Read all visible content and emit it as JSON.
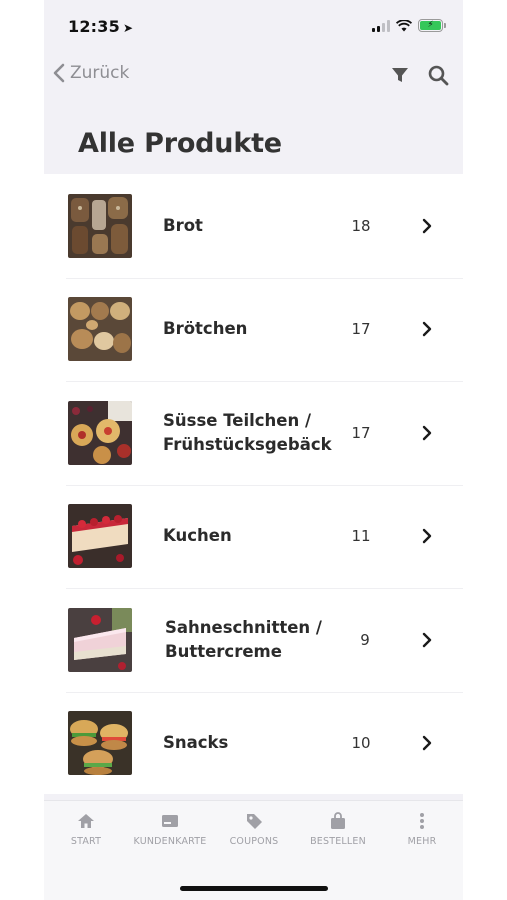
{
  "status": {
    "time": "12:35"
  },
  "nav": {
    "back_label": "Zurück"
  },
  "page": {
    "title": "Alle Produkte"
  },
  "categories": [
    {
      "label": "Brot",
      "count": "18",
      "image": "bread-image"
    },
    {
      "label": "Brötchen",
      "count": "17",
      "image": "rolls-image"
    },
    {
      "label": "Süsse Teilchen / Frühstücksgebäck",
      "count": "17",
      "image": "pastry-image"
    },
    {
      "label": "Kuchen",
      "count": "11",
      "image": "cake-image"
    },
    {
      "label": "Sahneschnitten / Buttercreme",
      "count": "9",
      "image": "cream-slice-image"
    },
    {
      "label": "Snacks",
      "count": "10",
      "image": "snacks-image"
    }
  ],
  "tabbar": {
    "items": [
      {
        "label": "START",
        "icon": "home-icon"
      },
      {
        "label": "KUNDENKARTE",
        "icon": "card-icon"
      },
      {
        "label": "COUPONS",
        "icon": "tag-icon"
      },
      {
        "label": "BESTELLEN",
        "icon": "bag-icon"
      },
      {
        "label": "MEHR",
        "icon": "more-icon"
      }
    ]
  },
  "colors": {
    "background": "#f2f1f6",
    "list_background": "#ffffff",
    "accent_battery": "#36c759",
    "text": "#2b2b2b",
    "muted": "#a0a0a6"
  }
}
